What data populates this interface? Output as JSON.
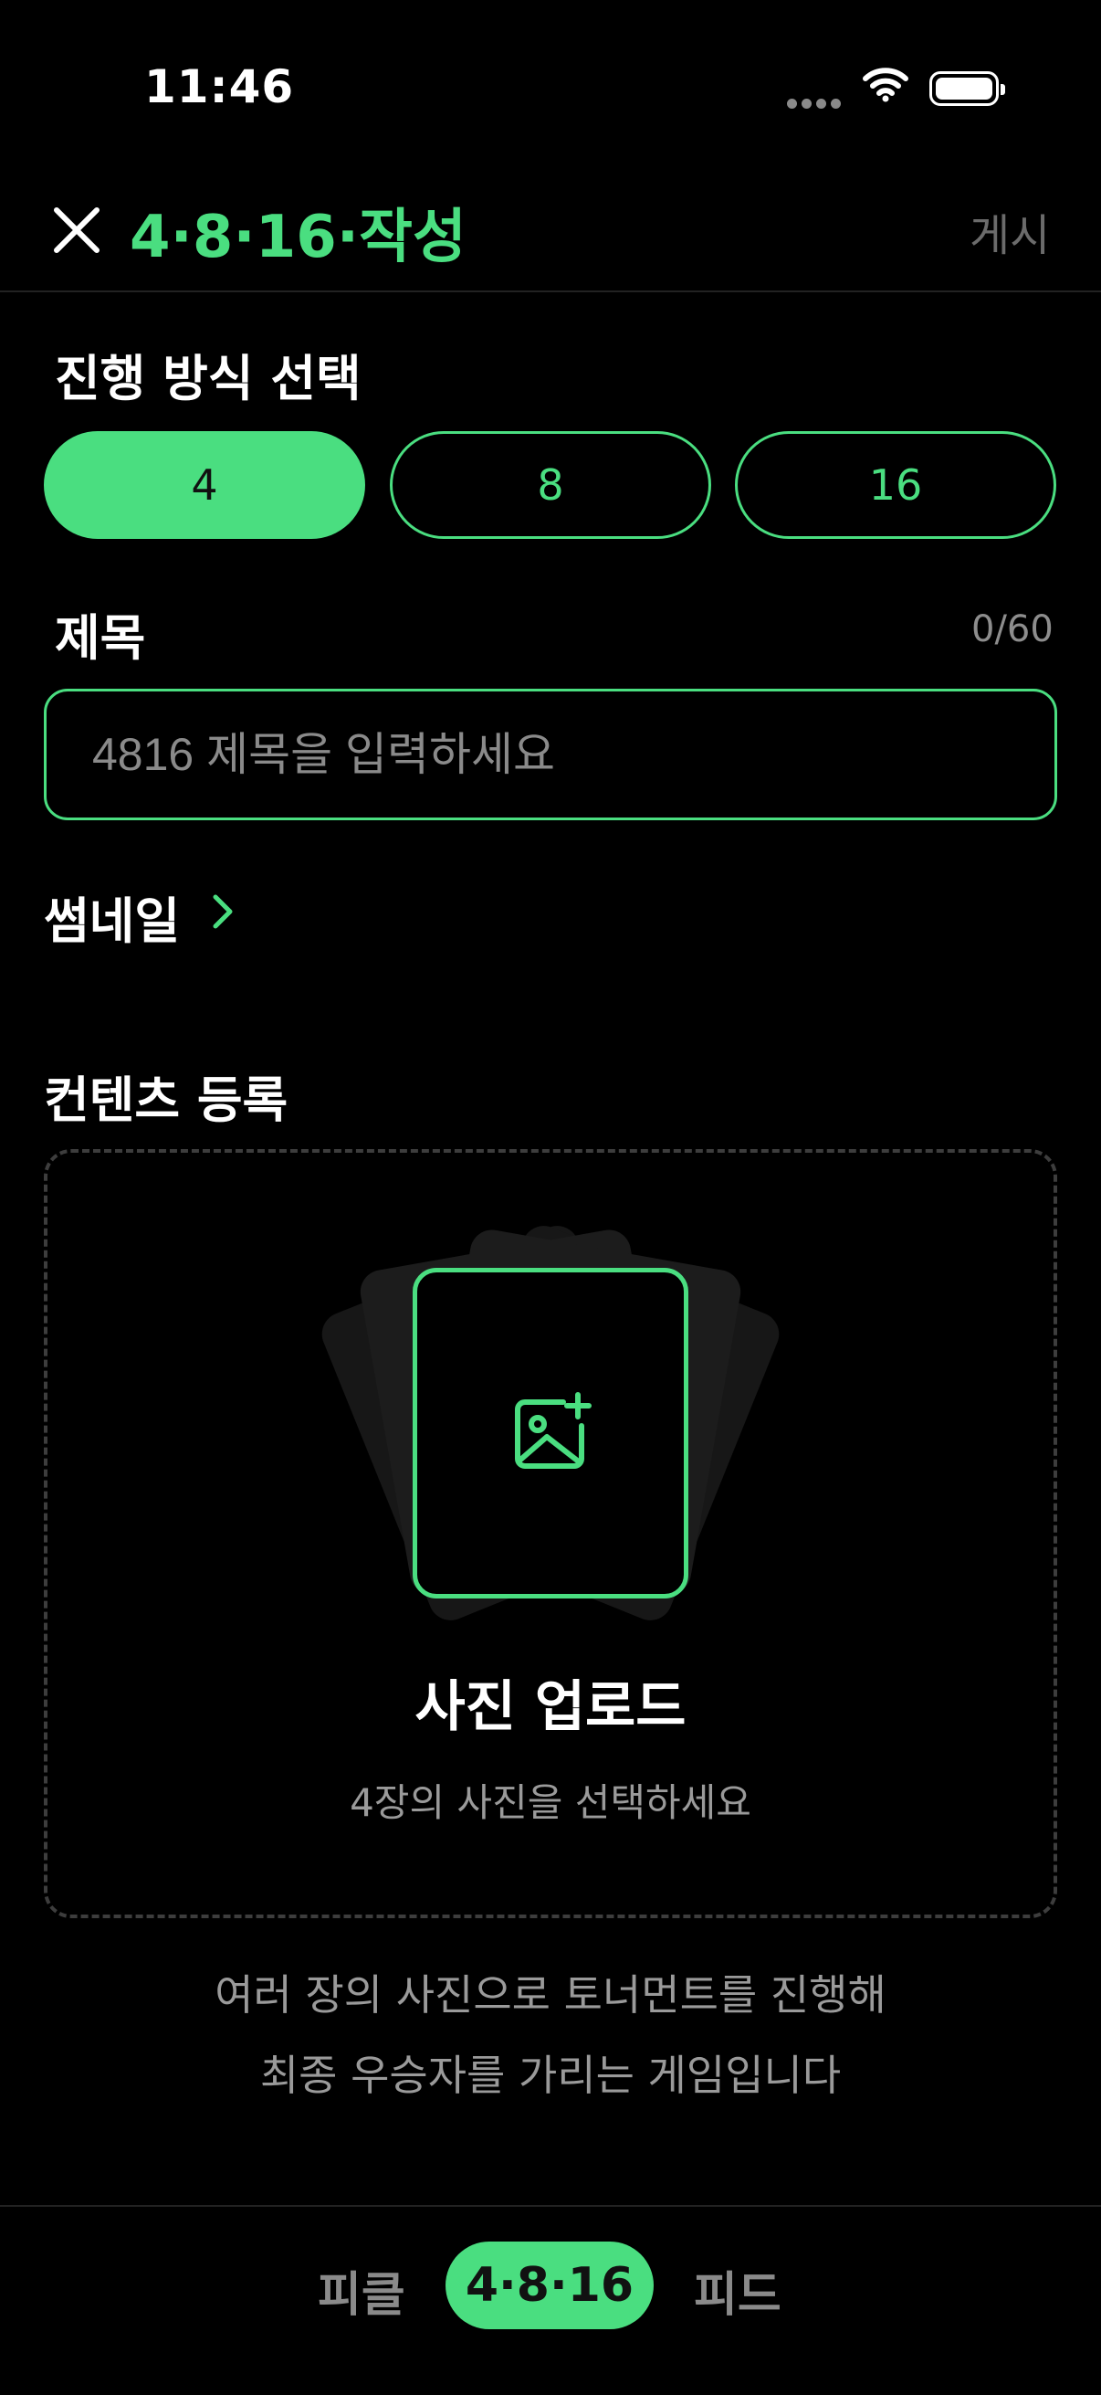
{
  "status_bar": {
    "time": "11:46"
  },
  "header": {
    "title": "4·8·16·작성",
    "post_label": "게시"
  },
  "mode": {
    "label": "진행 방식 선택",
    "options": [
      "4",
      "8",
      "16"
    ],
    "selected": "4"
  },
  "title_field": {
    "label": "제목",
    "counter": "0/60",
    "placeholder": "4816 제목을 입력하세요",
    "value": ""
  },
  "thumbnail": {
    "label": "썸네일"
  },
  "content": {
    "label": "컨텐츠 등록",
    "upload_title": "사진 업로드",
    "upload_subtitle": "4장의 사진을 선택하세요"
  },
  "description": {
    "line1": "여러 장의 사진으로 토너먼트를 진행해",
    "line2": "최종 우승자를 가리는 게임입니다"
  },
  "bottom_nav": {
    "left": "피클",
    "center": "4·8·16",
    "right": "피드"
  },
  "colors": {
    "accent": "#4ade80",
    "background": "#000000"
  }
}
